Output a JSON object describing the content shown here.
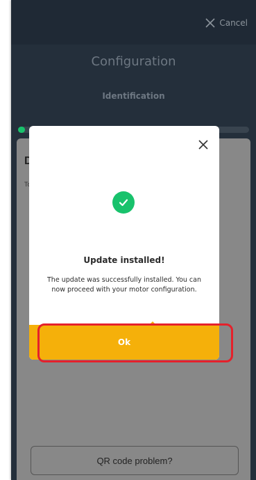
{
  "header": {
    "cancel_label": "Cancel",
    "cancel_icon": "close-icon"
  },
  "page": {
    "title": "Configuration",
    "subtitle": "Identification"
  },
  "progress": {
    "fraction": 0.03,
    "color": "#18c26c"
  },
  "background_sheet": {
    "heading": "De",
    "text": "To",
    "qr_button_label": "QR code problem?"
  },
  "modal": {
    "close_icon": "close-icon",
    "status_icon": "check-circle-icon",
    "title": "Update installed!",
    "message": "The update was successfully installed. You can now proceed with your motor configuration.",
    "ok_label": "Ok",
    "accent_color": "#f5b00a",
    "success_color": "#18c26c",
    "highlight_color": "#e5212b"
  }
}
